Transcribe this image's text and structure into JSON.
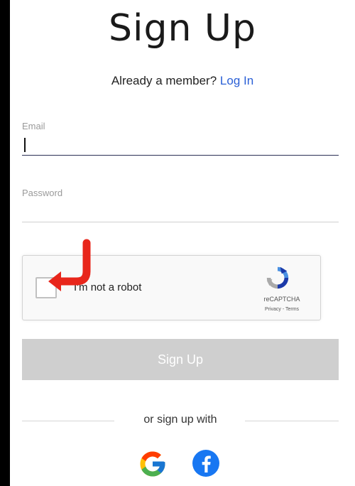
{
  "page": {
    "title": "Sign Up"
  },
  "member_line": {
    "text": "Already a member?",
    "login_link": "Log In"
  },
  "form": {
    "email_label": "Email",
    "email_value": "",
    "password_label": "Password",
    "password_value": ""
  },
  "recaptcha": {
    "checkbox_label": "I'm not a robot",
    "brand": "reCAPTCHA",
    "terms": "Privacy - Terms"
  },
  "signup_button": {
    "label": "Sign Up"
  },
  "social": {
    "divider_text": "or sign up with",
    "google_icon": "google-icon",
    "facebook_icon": "facebook-icon"
  },
  "colors": {
    "accent": "#2a5fd6",
    "button_disabled": "#cfcfcf",
    "annotation_arrow": "#e8261b",
    "facebook": "#1877f2"
  }
}
